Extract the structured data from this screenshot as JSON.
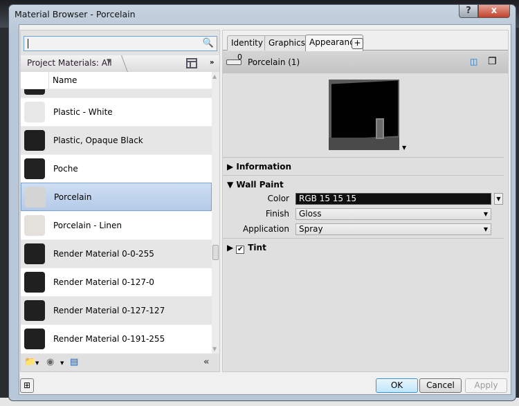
{
  "window": {
    "title": "Material Browser - Porcelain",
    "help_label": "?",
    "close_label": "x"
  },
  "browser": {
    "search": {
      "value": "",
      "placeholder": ""
    },
    "library_filter": "Project Materials: All",
    "column_header": "Name",
    "materials": [
      {
        "name": "Plastic - White",
        "swatch": "#e8e8e8"
      },
      {
        "name": "Plastic, Opaque Black",
        "swatch": "#1e1e1e"
      },
      {
        "name": "Poche",
        "swatch": "#222222"
      },
      {
        "name": "Porcelain",
        "swatch": "#d4d4d4",
        "selected": true
      },
      {
        "name": "Porcelain - Linen",
        "swatch": "#e4e0dc"
      },
      {
        "name": "Render Material 0-0-255",
        "swatch": "#202020"
      },
      {
        "name": "Render Material 0-127-0",
        "swatch": "#202020"
      },
      {
        "name": "Render Material 0-127-127",
        "swatch": "#202020"
      },
      {
        "name": "Render Material 0-191-255",
        "swatch": "#202020"
      }
    ]
  },
  "editor": {
    "tabs": [
      "Identity",
      "Graphics",
      "Appearance"
    ],
    "active_tab": "Appearance",
    "add_tab_label": "+",
    "asset_usage_count": "0",
    "asset_name": "Porcelain (1)",
    "sections": {
      "information": "Information",
      "wall_paint": "Wall Paint",
      "tint": "Tint"
    },
    "properties": {
      "color_label": "Color",
      "color_value": "RGB 15 15 15",
      "finish_label": "Finish",
      "finish_value": "Gloss",
      "application_label": "Application",
      "application_value": "Spray"
    },
    "tint_checked": true
  },
  "buttons": {
    "ok": "OK",
    "cancel": "Cancel",
    "apply": "Apply"
  }
}
